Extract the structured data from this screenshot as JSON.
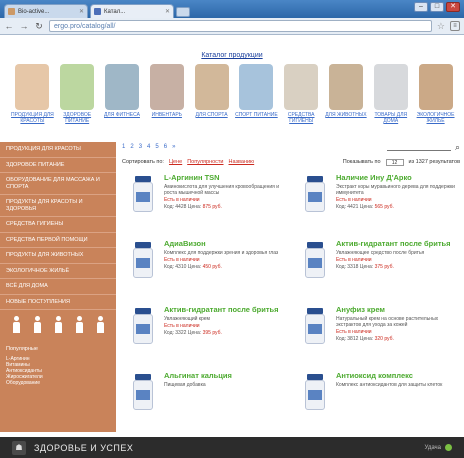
{
  "browser": {
    "tabs": [
      {
        "title": "Bio-active...",
        "active": false
      },
      {
        "title": "Катал...",
        "active": true
      }
    ],
    "url": "ergo.pro/catalog/all/"
  },
  "colors": {
    "sidebar_bg": "#c9835a",
    "product_name": "#4caa2f",
    "accent_red": "#cc2a1f",
    "link_blue": "#3a6bc9"
  },
  "page": {
    "catalog_title": "Каталог продукции",
    "categories": [
      {
        "label": "ПРОДУКЦИЯ ДЛЯ КРАСОТЫ",
        "color": "#e6c7a8"
      },
      {
        "label": "ЗДОРОВОЕ ПИТАНИЕ",
        "color": "#bcd7a0"
      },
      {
        "label": "ДЛЯ ФИТНЕСА",
        "color": "#9fb7c7"
      },
      {
        "label": "ИНВЕНТАРЬ",
        "color": "#c7b0a4"
      },
      {
        "label": "ДЛЯ СПОРТА",
        "color": "#d2b89a"
      },
      {
        "label": "СПОРТ ПИТАНИЕ",
        "color": "#a7c3dc"
      },
      {
        "label": "СРЕДСТВА ГИГИЕНЫ",
        "color": "#d9d0c2"
      },
      {
        "label": "ДЛЯ ЖИВОТНЫХ",
        "color": "#c9b397"
      },
      {
        "label": "ТОВАРЫ ДЛЯ ДОМА",
        "color": "#d7d9dc"
      },
      {
        "label": "ЭКОЛОГИЧНОЕ ЖИЛЬЕ",
        "color": "#cba987"
      }
    ],
    "pager": {
      "pages": [
        "1",
        "2",
        "3",
        "4",
        "5",
        "6",
        "»"
      ]
    },
    "sort": {
      "label": "Сортировать по:",
      "options": [
        "Цене",
        "Популярности",
        "Названию"
      ],
      "perpage_label": "Показывать по",
      "perpage_value": "12",
      "perpage_suffix": "из 1327 результатов"
    }
  },
  "sidebar": {
    "items": [
      "Продукция для красоты",
      "Здоровое питание",
      "Оборудование для массажа и спорта",
      "Продукты для красоты и здоровья",
      "Средства гигиены",
      "Средства первой помощи",
      "Продукты для животных",
      "Экологичное жильё",
      "Всё для дома",
      "Новые поступления"
    ],
    "footer_title": "Популярные",
    "footer_lines": [
      "L-Аргинин",
      "Витамины",
      "Антиоксиданты",
      "Жиросжигатели",
      "Оборудование"
    ]
  },
  "products": [
    {
      "name": "L-Аргинин TSN",
      "desc": "Аминокислота для улучшения кровообращения и роста мышечной массы",
      "stock": "Есть в наличии",
      "price_label": "Код: 4428 Цена:",
      "price": "875 руб."
    },
    {
      "name": "Наличие Ину Д'Арко",
      "desc": "Экстракт коры муравьиного дерева для поддержки иммунитета",
      "stock": "Есть в наличии",
      "price_label": "Код: 4421 Цена:",
      "price": "565 руб."
    },
    {
      "name": "АдиаВизон",
      "desc": "Комплекс для поддержки зрения и здоровья глаз",
      "stock": "Есть в наличии",
      "price_label": "Код: 4310 Цена:",
      "price": "450 руб."
    },
    {
      "name": "Актив-гидратант после бритья",
      "desc": "Увлажняющее средство после бритья",
      "stock": "Есть в наличии",
      "price_label": "Код: 3318 Цена:",
      "price": "375 руб."
    },
    {
      "name": "Актив-гидратант после бритья",
      "desc": "Увлажняющий крем",
      "stock": "Есть в наличии",
      "price_label": "Код: 3322 Цена:",
      "price": "395 руб."
    },
    {
      "name": "Ануфиз крем",
      "desc": "Натуральный крем на основе растительных экстрактов для ухода за кожей",
      "stock": "Есть в наличии",
      "price_label": "Код: 3812 Цена:",
      "price": "320 руб."
    },
    {
      "name": "Альгинат кальция",
      "desc": "Пищевая добавка",
      "stock": "",
      "price_label": "",
      "price": ""
    },
    {
      "name": "Антиоксид комплекс",
      "desc": "Комплекс антиоксидантов для защиты клеток",
      "stock": "",
      "price_label": "",
      "price": ""
    }
  ],
  "bottom": {
    "title": "ЗДОРОВЬЕ И УСПЕХ",
    "right": "Удача"
  }
}
